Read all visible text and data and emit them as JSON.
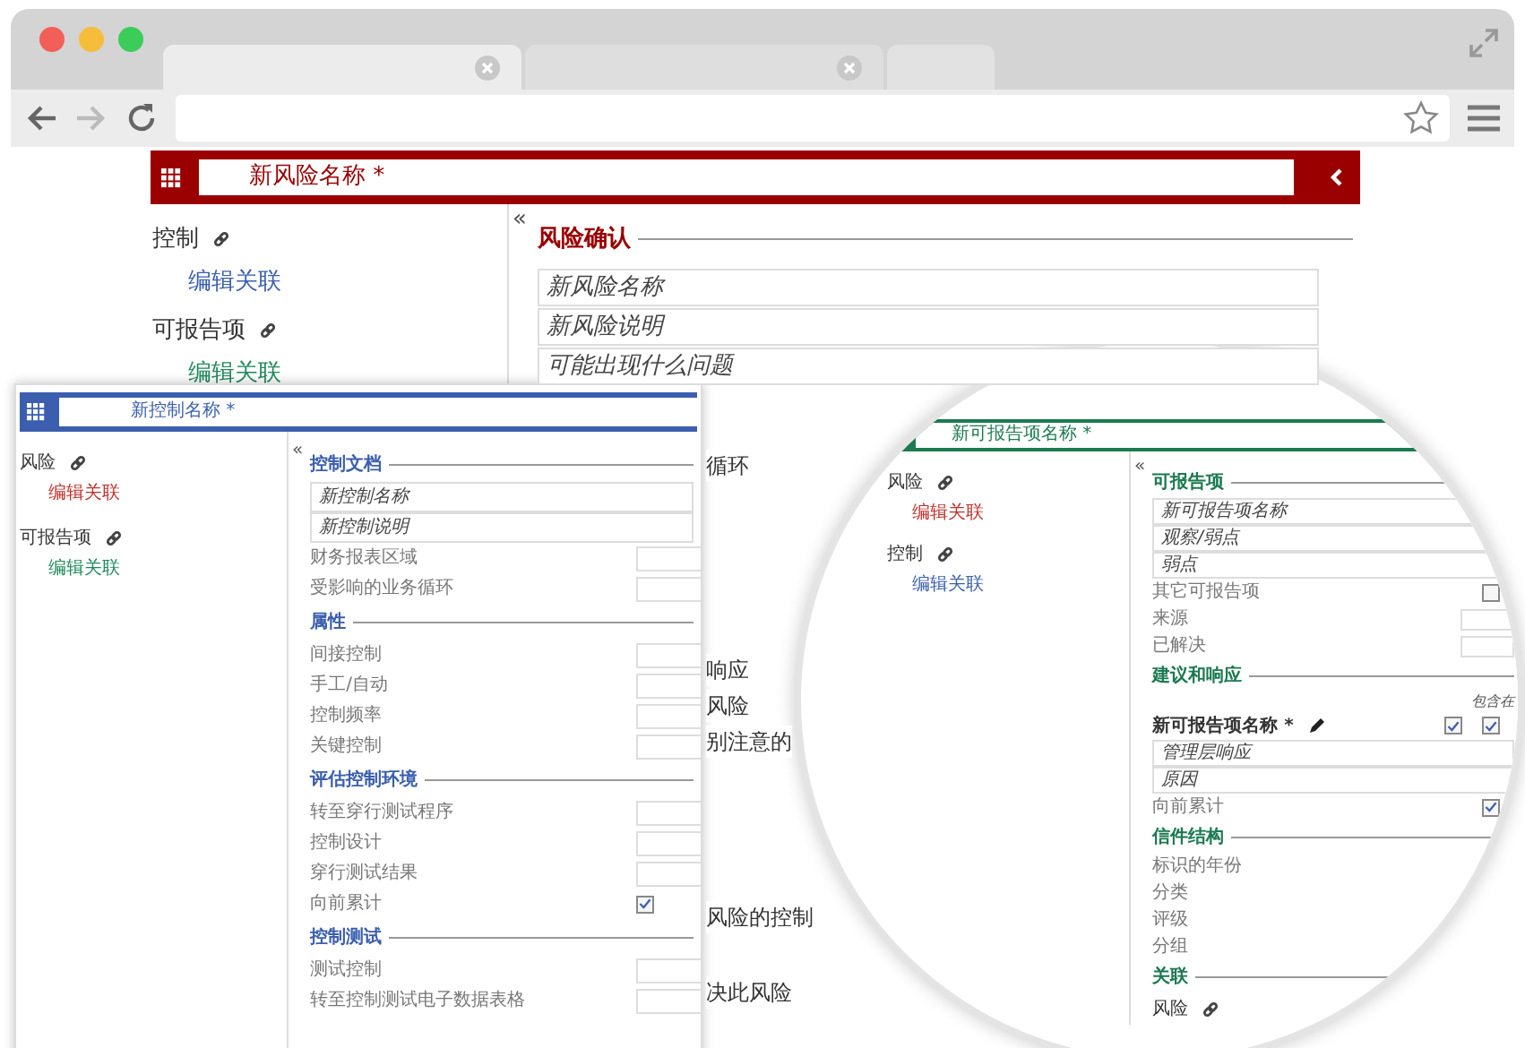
{
  "risk_form": {
    "title": "新风险名称 *",
    "associations": [
      {
        "label": "控制",
        "link": {
          "label": "编辑关联",
          "color": "#3a5fb0"
        }
      },
      {
        "label": "可报告项",
        "link": {
          "label": "编辑关联",
          "color": "#1f8a5a"
        }
      }
    ],
    "toggle": "«",
    "sections": [
      {
        "title": "风险确认",
        "items": [
          {
            "kind": "field",
            "placeholder": "新风险名称"
          },
          {
            "kind": "field",
            "placeholder": "新风险说明"
          },
          {
            "kind": "field",
            "placeholder": "可能出现什么问题"
          }
        ]
      }
    ],
    "partial_texts": [
      "循环",
      "响应",
      "风险",
      "别注意的",
      "风险的控制",
      "决此风险"
    ]
  },
  "control_form": {
    "title": "新控制名称 *",
    "associations": [
      {
        "label": "风险",
        "link": {
          "label": "编辑关联",
          "color": "#c0302b"
        }
      },
      {
        "label": "可报告项",
        "link": {
          "label": "编辑关联",
          "color": "#1f8a5a"
        }
      }
    ],
    "toggle": "«",
    "sections": [
      {
        "title": "控制文档",
        "items": [
          {
            "kind": "field",
            "placeholder": "新控制名称"
          },
          {
            "kind": "field",
            "placeholder": "新控制说明"
          },
          {
            "kind": "row",
            "label": "财务报表区域"
          },
          {
            "kind": "row",
            "label": "受影响的业务循环"
          }
        ]
      },
      {
        "title": "属性",
        "items": [
          {
            "kind": "row",
            "label": "间接控制"
          },
          {
            "kind": "row",
            "label": "手工/自动"
          },
          {
            "kind": "row",
            "label": "控制频率"
          },
          {
            "kind": "row",
            "label": "关键控制"
          }
        ]
      },
      {
        "title": "评估控制环境",
        "items": [
          {
            "kind": "row",
            "label": "转至穿行测试程序"
          },
          {
            "kind": "row",
            "label": "控制设计"
          },
          {
            "kind": "row",
            "label": "穿行测试结果"
          },
          {
            "kind": "checkbox",
            "label": "向前累计",
            "checked": true
          }
        ]
      },
      {
        "title": "控制测试",
        "items": [
          {
            "kind": "row",
            "label": "测试控制"
          },
          {
            "kind": "row",
            "label": "转至控制测试电子数据表格"
          }
        ]
      }
    ]
  },
  "reportable_form": {
    "title": "新可报告项名称 *",
    "associations": [
      {
        "label": "风险",
        "link": {
          "label": "编辑关联",
          "color": "#c0302b"
        }
      },
      {
        "label": "控制",
        "link": {
          "label": "编辑关联",
          "color": "#3a5fb0"
        }
      }
    ],
    "toggle": "«",
    "sections": [
      {
        "title": "可报告项",
        "items": [
          {
            "kind": "field",
            "placeholder": "新可报告项名称"
          },
          {
            "kind": "field",
            "placeholder": "观察/弱点"
          },
          {
            "kind": "field",
            "placeholder": "弱点"
          },
          {
            "kind": "checkbox",
            "label": "其它可报告项",
            "checked": false
          },
          {
            "kind": "row",
            "label": "来源"
          },
          {
            "kind": "row",
            "label": "已解决"
          }
        ]
      },
      {
        "title": "建议和响应",
        "items": [
          {
            "kind": "note",
            "text": "包含在"
          },
          {
            "kind": "flag",
            "label": "新可报告项名称 *",
            "flags": [
              {
                "checked": true
              },
              {
                "checked": true
              }
            ]
          },
          {
            "kind": "field",
            "placeholder": "管理层响应"
          },
          {
            "kind": "field",
            "placeholder": "原因"
          },
          {
            "kind": "checkbox",
            "label": "向前累计",
            "checked": true
          }
        ]
      },
      {
        "title": "信件结构",
        "items": [
          {
            "kind": "label",
            "label": "标识的年份"
          },
          {
            "kind": "label",
            "label": "分类"
          },
          {
            "kind": "label",
            "label": "评级"
          },
          {
            "kind": "label",
            "label": "分组"
          }
        ]
      },
      {
        "title": "关联",
        "items": [
          {
            "kind": "link",
            "label": "风险"
          }
        ]
      }
    ]
  }
}
